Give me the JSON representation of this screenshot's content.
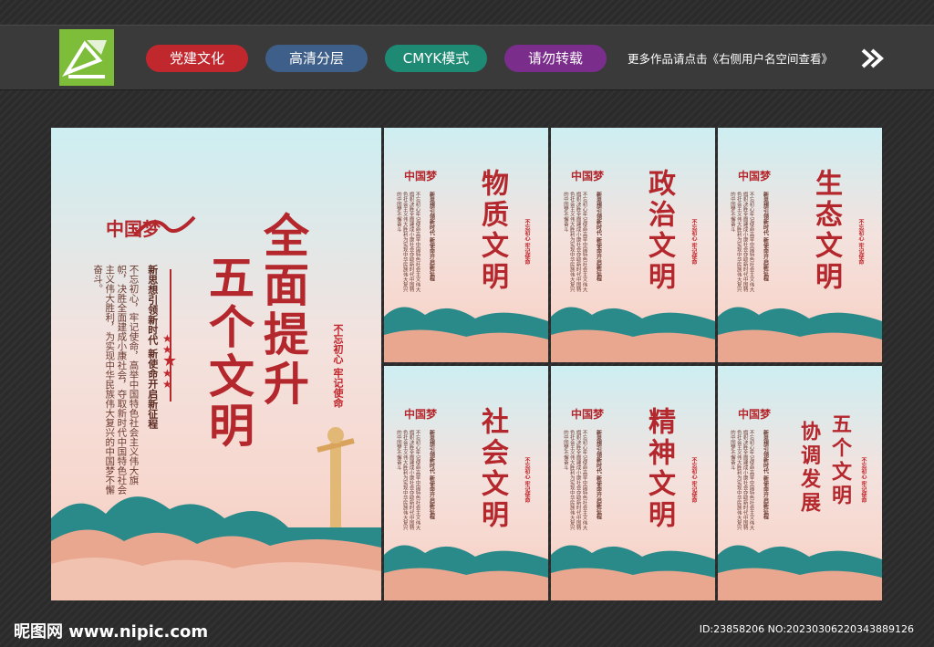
{
  "header": {
    "tags": [
      {
        "label": "党建文化",
        "color": "#c0282e"
      },
      {
        "label": "高清分层",
        "color": "#3d5f8a"
      },
      {
        "label": "CMYK模式",
        "color": "#1f8a74"
      },
      {
        "label": "请勿转载",
        "color": "#7b2d8c"
      }
    ],
    "hint": "更多作品请点击《右侧用户名空间查看》"
  },
  "posters": {
    "main": {
      "title_line1": "全面提升",
      "title_line2": "五个文明",
      "subtitle": "新思想引领新时代 新使命开启新征程",
      "body": "不忘初心，牢记使命，高举中国特色社会主义伟大旗帜，决胜全面建成小康社会，夺取新时代中国特色社会主义伟大胜利，为实现中华民族伟大复兴的中国梦不懈奋斗。",
      "seal": "不忘初心 牢记使命",
      "logo": "中国梦"
    },
    "items": [
      {
        "title": "物质文明"
      },
      {
        "title": "政治文明"
      },
      {
        "title": "生态文明"
      },
      {
        "title": "社会文明"
      },
      {
        "title": "精神文明"
      },
      {
        "title_line1": "五个文明",
        "title_line2": "协调发展"
      }
    ],
    "small_subtitle": "新思想引领新时代 新使命开启新征程",
    "small_body": "不忘初心牢记使命高举中国特色社会主义伟大旗帜决胜全面建成小康社会夺取新时代中国特色社会主义伟大胜利为实现中华民族伟大复兴的中国梦不懈奋斗",
    "small_seal": "不忘初心 牢记使命",
    "small_logo": "中国梦"
  },
  "footer": {
    "site": "昵图网 www.nipic.com",
    "id": "ID:23858206 NO:20230306220343889126"
  }
}
